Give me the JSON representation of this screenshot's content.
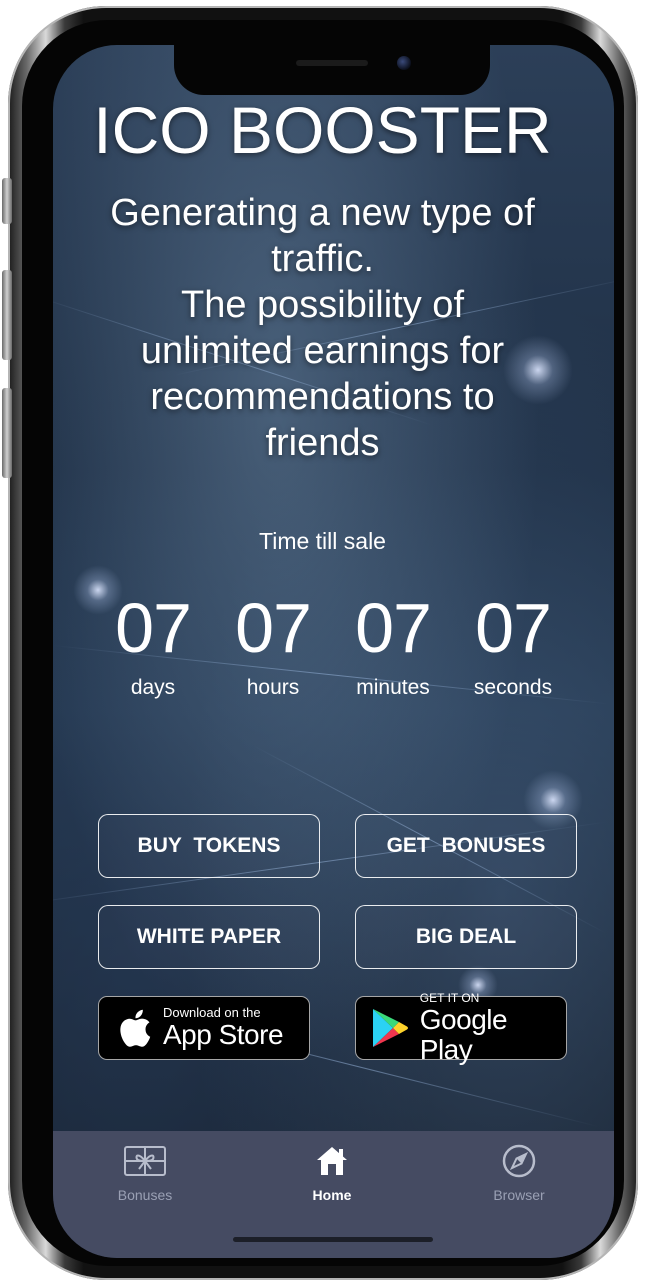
{
  "app": {
    "title": "ICO BOOSTER",
    "subtitle_lines": [
      "Generating a new type of",
      "traffic.",
      "The possibility of",
      "unlimited earnings for",
      "recommendations to",
      "friends"
    ]
  },
  "countdown": {
    "label": "Time till sale",
    "units": [
      {
        "value": "07",
        "label": "days"
      },
      {
        "value": "07",
        "label": "hours"
      },
      {
        "value": "07",
        "label": "minutes"
      },
      {
        "value": "07",
        "label": "seconds"
      }
    ]
  },
  "buttons": {
    "buy_tokens": "BUY TOKENS",
    "get_bonuses": "GET BONUSES",
    "white_paper": "WHITE PAPER",
    "big_deal": "BIG DEAL"
  },
  "stores": {
    "app_store": {
      "small": "Download on the",
      "big": "App Store",
      "icon": "apple-icon"
    },
    "google_play": {
      "small": "GET IT ON",
      "big": "Google Play",
      "icon": "google-play-icon"
    }
  },
  "tabbar": {
    "items": [
      {
        "label": "Bonuses",
        "icon": "gift-icon",
        "active": false
      },
      {
        "label": "Home",
        "icon": "home-icon",
        "active": true
      },
      {
        "label": "Browser",
        "icon": "compass-icon",
        "active": false
      }
    ],
    "colors": {
      "active": "#ffffff",
      "inactive": "#9aa0b4",
      "background": "#454b62"
    }
  }
}
